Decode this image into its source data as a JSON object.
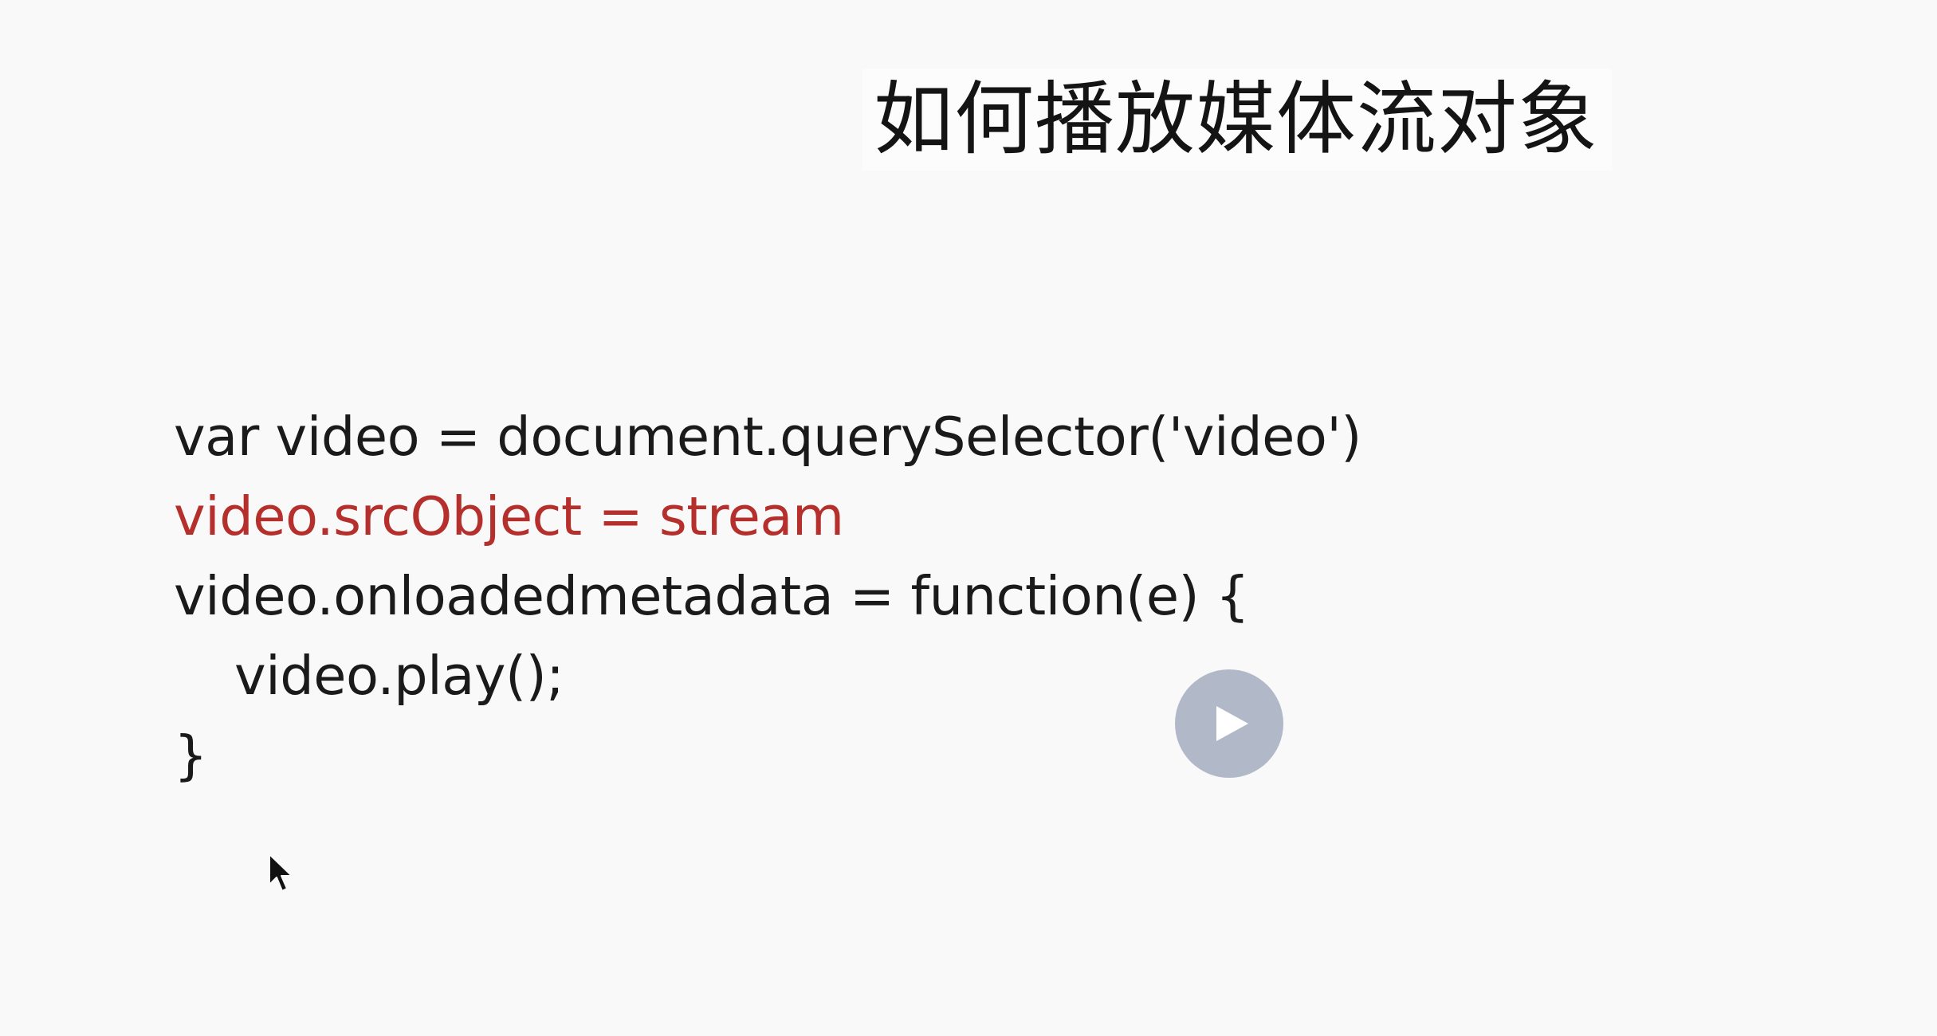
{
  "slide": {
    "title": "如何播放媒体流对象",
    "code_lines": [
      "var video = document.querySelector('video')",
      "video.srcObject = stream",
      "video.onloadedmetadata = function(e) {",
      "video.play();",
      "}"
    ]
  },
  "player": {
    "play_icon": "play-icon"
  },
  "colors": {
    "background": "#f9f9f9",
    "text": "#1a1a1a",
    "highlight": "#b5302c",
    "play_button": "#b1b8c7"
  }
}
